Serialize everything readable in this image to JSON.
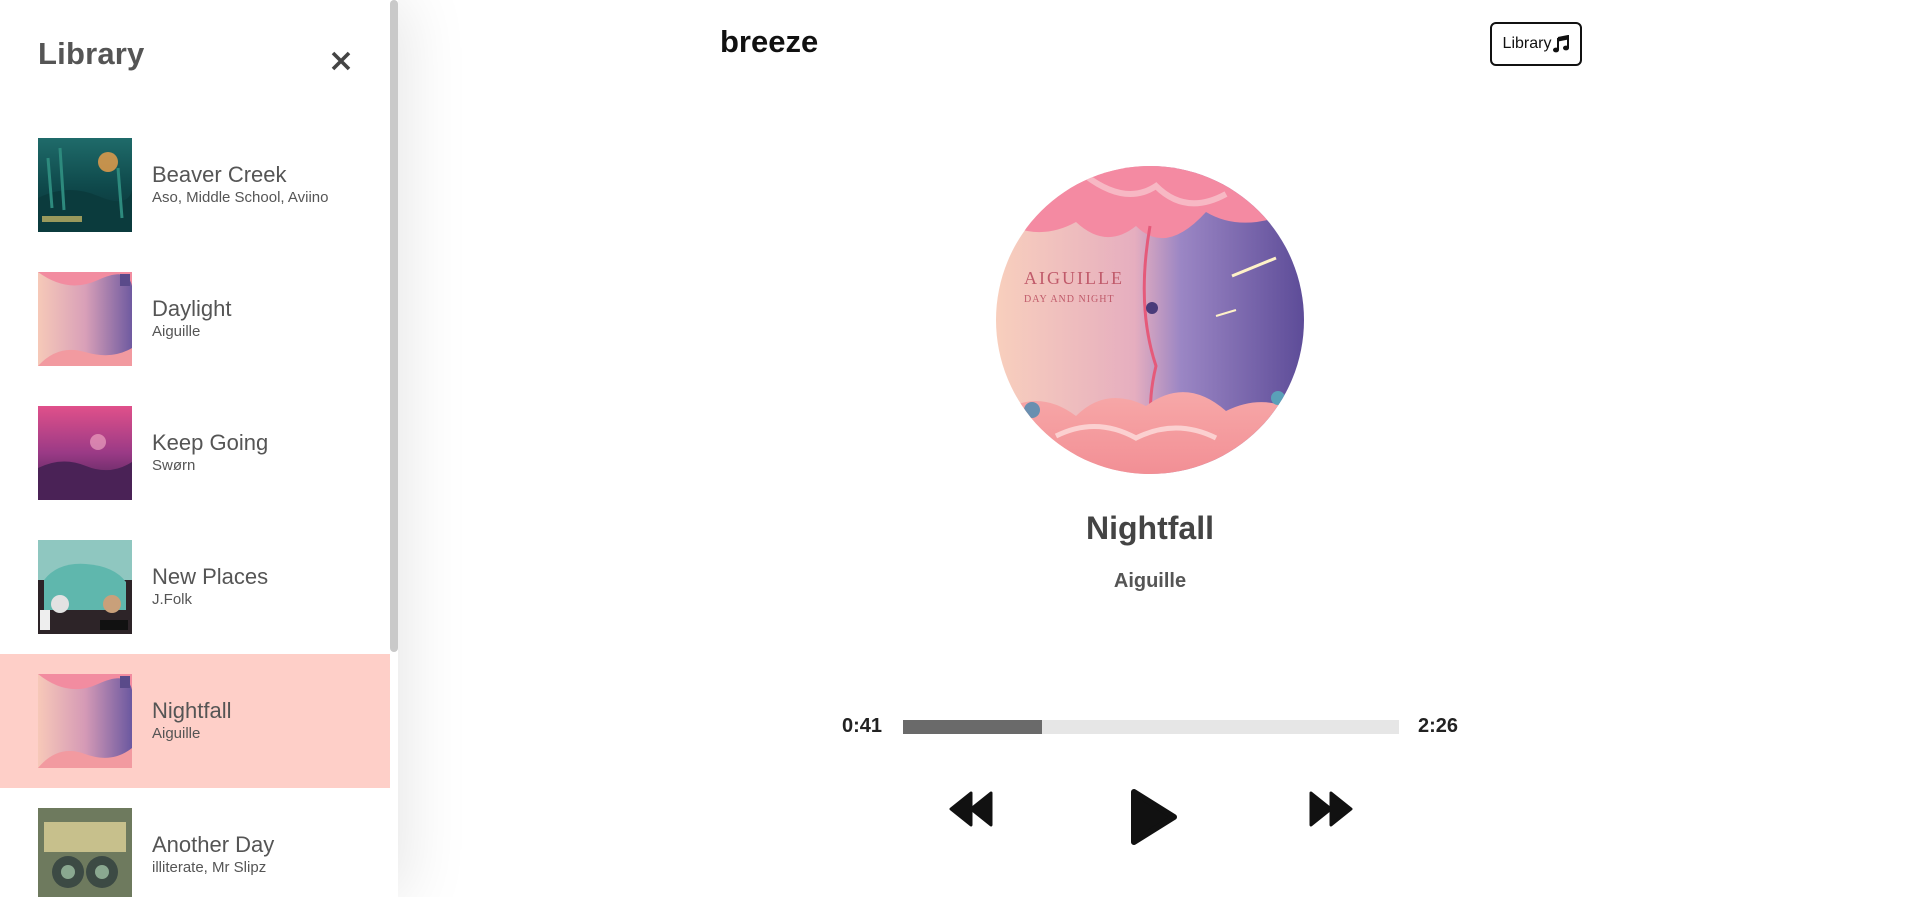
{
  "sidebar": {
    "title": "Library",
    "close_icon": "close-icon",
    "songs": [
      {
        "name": "Beaver Creek",
        "artist": "Aso, Middle School, Aviino",
        "active": false
      },
      {
        "name": "Daylight",
        "artist": "Aiguille",
        "active": false
      },
      {
        "name": "Keep Going",
        "artist": "Swørn",
        "active": false
      },
      {
        "name": "New Places",
        "artist": "J.Folk",
        "active": false
      },
      {
        "name": "Nightfall",
        "artist": "Aiguille",
        "active": true
      },
      {
        "name": "Another Day",
        "artist": "illiterate, Mr Slipz",
        "active": false
      }
    ]
  },
  "header": {
    "brand": "breeze",
    "library_button": "Library",
    "library_icon": "music-note-icon"
  },
  "player": {
    "title": "Nightfall",
    "artist": "Aiguille",
    "current_time": "0:41",
    "total_time": "2:26",
    "progress": 0.28,
    "prev_icon": "rewind-icon",
    "play_icon": "play-icon",
    "next_icon": "fast-forward-icon"
  },
  "colors": {
    "active_row": "#fecfc8",
    "track_bg": "#e6e6e6",
    "track_fill": "#6a6a6a"
  }
}
